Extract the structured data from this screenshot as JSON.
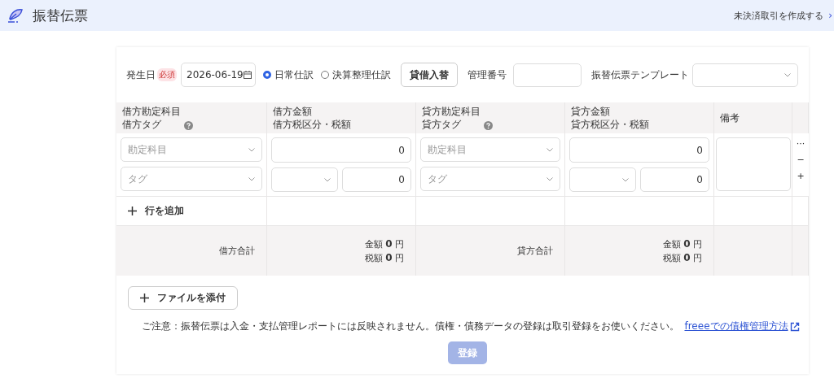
{
  "header": {
    "title": "振替伝票",
    "link": "未決済取引を作成する",
    "link_arrow": "›"
  },
  "form": {
    "date_label": "発生日",
    "required_badge": "必須",
    "date_value": "2026-06-19",
    "radios": [
      {
        "label": "日常仕訳",
        "selected": true
      },
      {
        "label": "決算整理仕訳",
        "selected": false
      }
    ],
    "swap_button": "貸借入替",
    "number_label": "管理番号",
    "template_label": "振替伝票テンプレート"
  },
  "table": {
    "columns": [
      {
        "line1": "借方勘定科目",
        "line2": "借方タグ",
        "help": true
      },
      {
        "line1": "借方金額",
        "line2": "借方税区分・税額",
        "help": false
      },
      {
        "line1": "貸方勘定科目",
        "line2": "貸方タグ",
        "help": true
      },
      {
        "line1": "貸方金額",
        "line2": "貸方税区分・税額",
        "help": false
      },
      {
        "line1": "備考",
        "help": false
      }
    ],
    "row": {
      "debit_account_placeholder": "勘定科目",
      "debit_tag_placeholder": "タグ",
      "debit_amount": "0",
      "debit_tax": "0",
      "credit_account_placeholder": "勘定科目",
      "credit_tag_placeholder": "タグ",
      "credit_amount": "0",
      "credit_tax": "0",
      "actions": [
        "···",
        "−",
        "+"
      ]
    },
    "add_row": "行を追加",
    "totals": [
      {
        "label": "借方合計",
        "amount_label": "金額",
        "amount": "0",
        "amount_unit": "円",
        "tax_label": "税額",
        "tax": "0",
        "tax_unit": "円"
      },
      {
        "label": "貸方合計",
        "amount_label": "金額",
        "amount": "0",
        "amount_unit": "円",
        "tax_label": "税額",
        "tax": "0",
        "tax_unit": "円"
      }
    ]
  },
  "attach_button": "ファイルを添付",
  "notice": "ご注意：振替伝票は入金・支払管理レポートには反映されません。債権・債務データの登録は取引登録をお使いください。",
  "notice_link": "freeeでの債権管理方法",
  "submit": {
    "label": "登録",
    "disabled": true
  }
}
